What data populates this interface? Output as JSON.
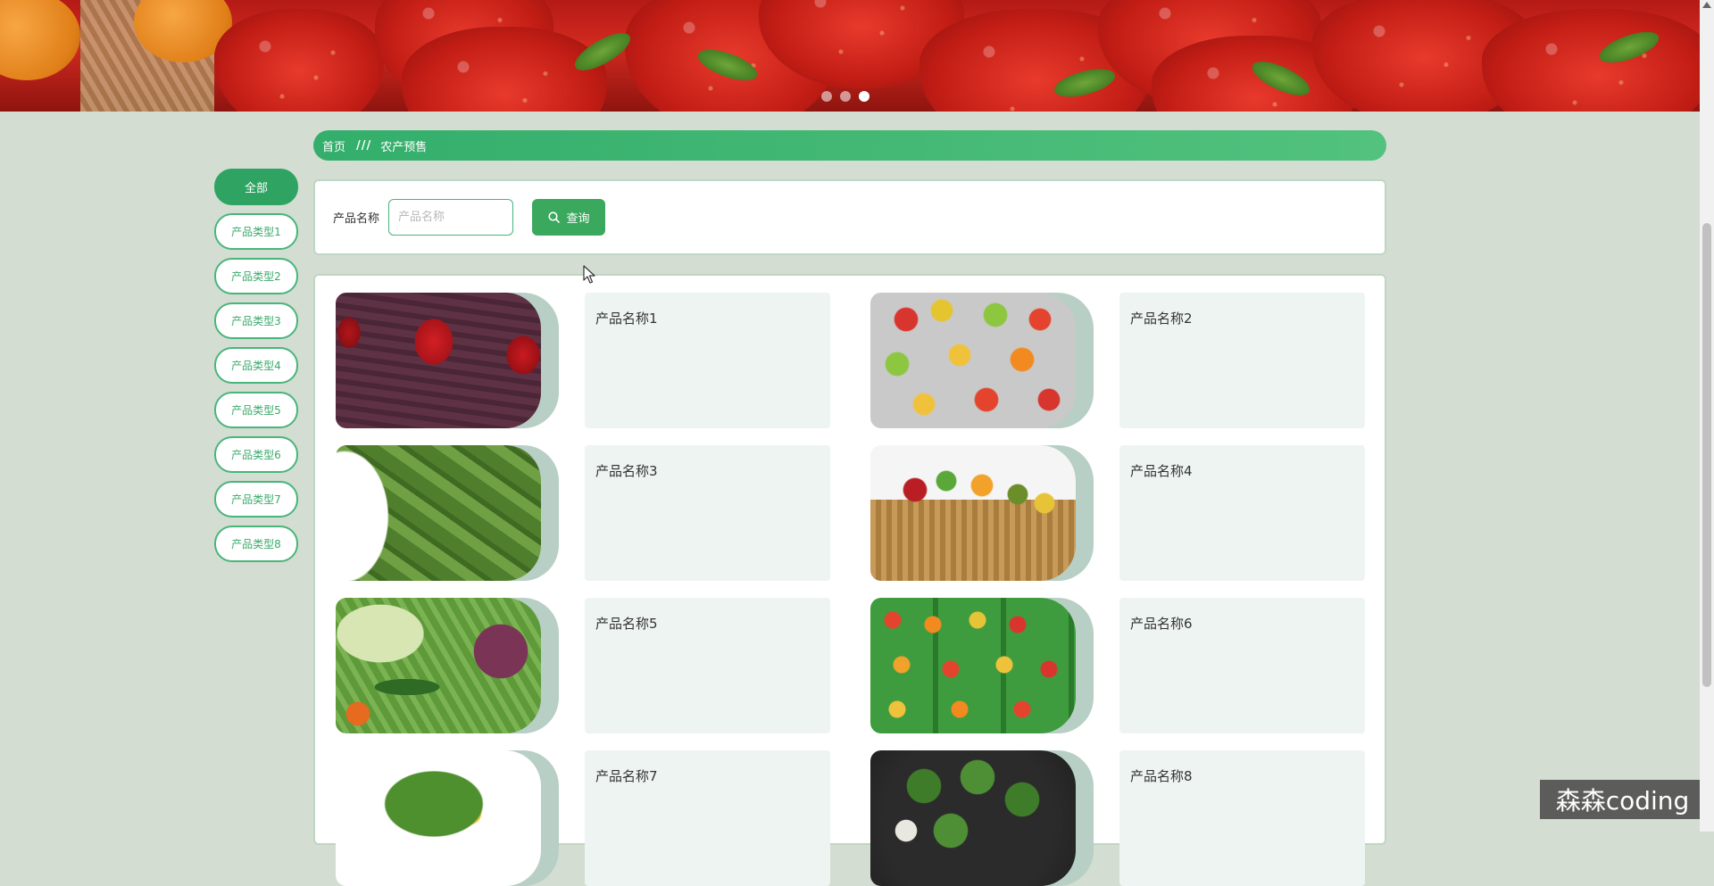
{
  "banner": {
    "slides": [
      {
        "label": "banner-slide-1"
      },
      {
        "label": "banner-slide-2"
      },
      {
        "label": "banner-slide-3"
      }
    ],
    "active_index": 2
  },
  "breadcrumb": {
    "home": "首页",
    "separator": "///",
    "current": "农产预售"
  },
  "sidebar": {
    "items": [
      {
        "label": "全部",
        "active": true
      },
      {
        "label": "产品类型1",
        "active": false
      },
      {
        "label": "产品类型2",
        "active": false
      },
      {
        "label": "产品类型3",
        "active": false
      },
      {
        "label": "产品类型4",
        "active": false
      },
      {
        "label": "产品类型5",
        "active": false
      },
      {
        "label": "产品类型6",
        "active": false
      },
      {
        "label": "产品类型7",
        "active": false
      },
      {
        "label": "产品类型8",
        "active": false
      }
    ]
  },
  "search": {
    "label": "产品名称",
    "placeholder": "产品名称",
    "value": "",
    "button_label": "查询",
    "button_icon": "search-icon"
  },
  "products": [
    {
      "name": "产品名称1",
      "image": "strawberry"
    },
    {
      "name": "产品名称2",
      "image": "fruits"
    },
    {
      "name": "产品名称3",
      "image": "okra-plate"
    },
    {
      "name": "产品名称4",
      "image": "basket"
    },
    {
      "name": "产品名称5",
      "image": "veg"
    },
    {
      "name": "产品名称6",
      "image": "market"
    },
    {
      "name": "产品名称7",
      "image": "greens"
    },
    {
      "name": "产品名称8",
      "image": "broccoli"
    }
  ],
  "watermark": "森森coding",
  "colors": {
    "accent": "#2fa462",
    "breadcrumb_bg": "#3fb472",
    "page_bg": "#d3ddd2",
    "card_info_bg": "#eef4f1"
  }
}
